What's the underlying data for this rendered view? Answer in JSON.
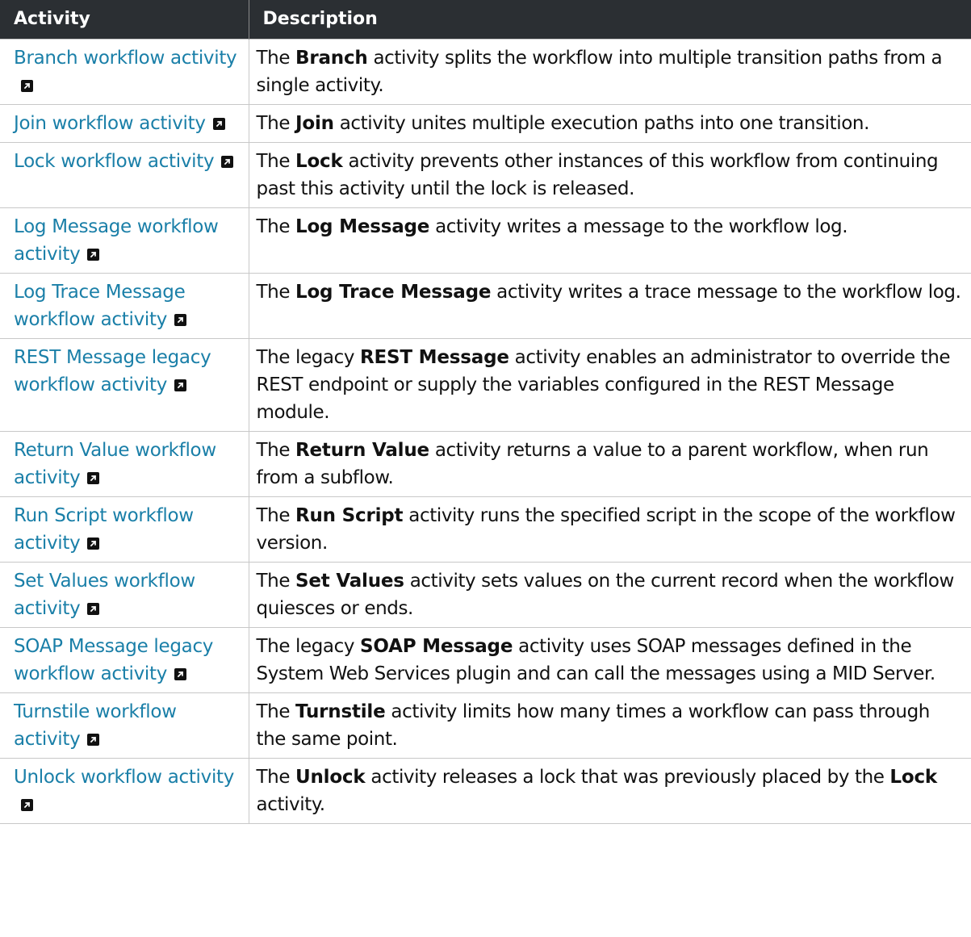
{
  "header": {
    "activity": "Activity",
    "description": "Description"
  },
  "rows": [
    {
      "activity": "Branch workflow activity",
      "desc": [
        "The ",
        {
          "b": "Branch"
        },
        " activity splits the workflow into multiple transition paths from a single activity."
      ]
    },
    {
      "activity": "Join workflow activity",
      "desc": [
        "The ",
        {
          "b": "Join"
        },
        " activity unites multiple execution paths into one transition."
      ]
    },
    {
      "activity": "Lock workflow activity",
      "desc": [
        "The ",
        {
          "b": "Lock"
        },
        " activity prevents other instances of this workflow from continuing past this activity until the lock is released."
      ]
    },
    {
      "activity": "Log Message workflow activity",
      "desc": [
        "The ",
        {
          "b": "Log Message"
        },
        " activity writes a message to the workflow log."
      ]
    },
    {
      "activity": "Log Trace Message workflow activity",
      "desc": [
        "The ",
        {
          "b": "Log Trace Message"
        },
        " activity writes a trace message to the workflow log."
      ]
    },
    {
      "activity": "REST Message legacy workflow activity",
      "desc": [
        "The legacy ",
        {
          "b": "REST Message"
        },
        " activity enables an administrator to override the REST endpoint or supply the variables configured in the REST Message module."
      ]
    },
    {
      "activity": "Return Value workflow activity",
      "desc": [
        "The ",
        {
          "b": "Return Value"
        },
        " activity returns a value to a parent workflow, when run from a subflow."
      ]
    },
    {
      "activity": "Run Script workflow activity",
      "desc": [
        "The ",
        {
          "b": "Run Script"
        },
        " activity runs the specified script in the scope of the workflow version."
      ]
    },
    {
      "activity": "Set Values workflow activity",
      "desc": [
        "The ",
        {
          "b": "Set Values"
        },
        " activity sets values on the current record when the workflow quiesces or ends."
      ]
    },
    {
      "activity": "SOAP Message legacy workflow activity",
      "desc": [
        "The legacy ",
        {
          "b": "SOAP Message"
        },
        " activity uses SOAP messages defined in the System Web Services plugin and can call the messages using a MID Server."
      ]
    },
    {
      "activity": "Turnstile workflow activity",
      "desc": [
        "The ",
        {
          "b": "Turnstile"
        },
        " activity limits how many times a workflow can pass through the same point."
      ]
    },
    {
      "activity": "Unlock workflow activity",
      "desc": [
        "The ",
        {
          "b": "Unlock"
        },
        " activity releases a lock that was previously placed by the ",
        {
          "b": "Lock"
        },
        " activity."
      ]
    }
  ],
  "icons": {
    "external_link": "external-link-icon"
  },
  "colors": {
    "header_bg": "#2b2f33",
    "link": "#1a7fa8"
  }
}
